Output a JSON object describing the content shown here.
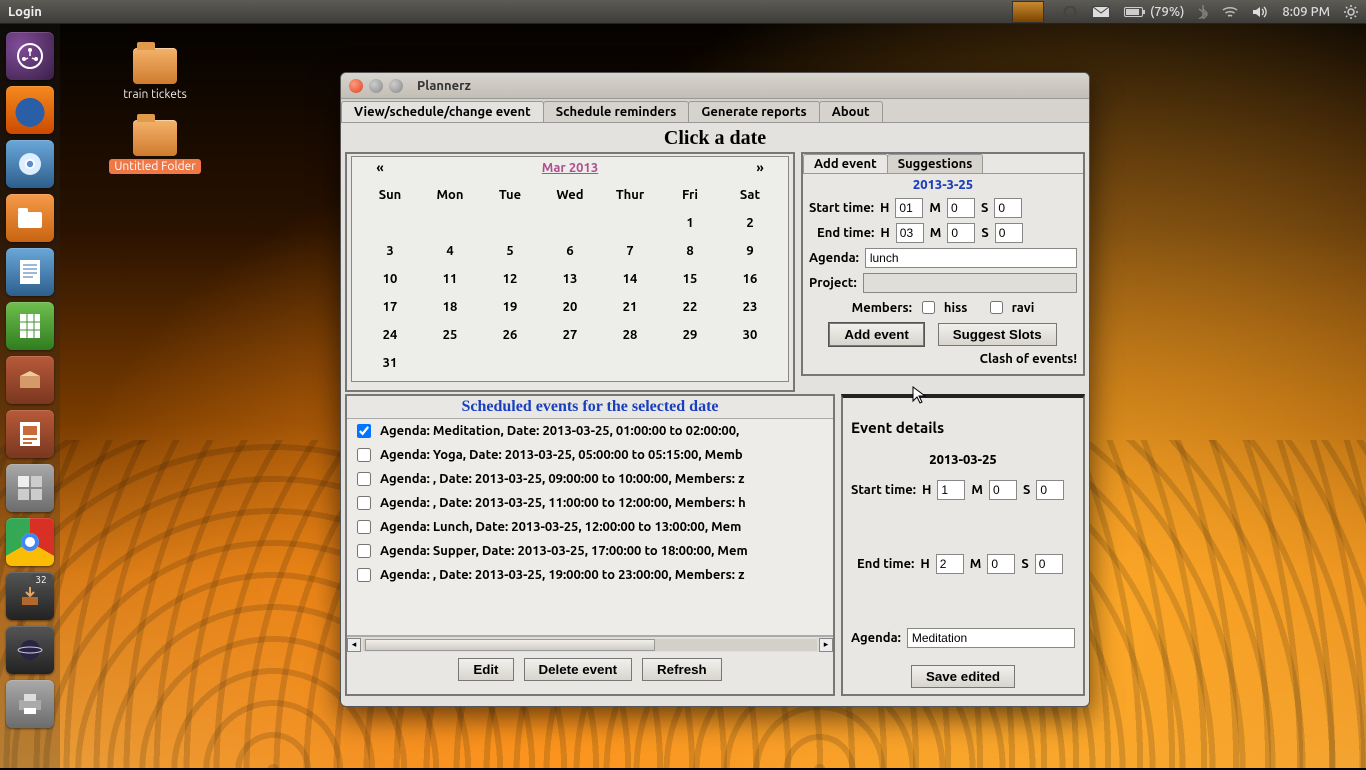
{
  "top_panel": {
    "title": "Login",
    "battery_text": "(79%)",
    "time": "8:09 PM"
  },
  "launcher": {
    "badge": "32"
  },
  "desktop": {
    "folder1": "train tickets",
    "folder2": "Untitled Folder"
  },
  "window": {
    "title": "Plannerz",
    "tabs": {
      "t1": "View/schedule/change event",
      "t2": "Schedule reminders",
      "t3": "Generate reports",
      "t4": "About"
    },
    "click_a_date": "Click a date",
    "calendar": {
      "month_label": "Mar 2013",
      "prev": "«",
      "next": "»",
      "dow": {
        "sun": "Sun",
        "mon": "Mon",
        "tue": "Tue",
        "wed": "Wed",
        "thu": "Thur",
        "fri": "Fri",
        "sat": "Sat"
      }
    },
    "right": {
      "tab_add": "Add event",
      "tab_sugg": "Suggestions",
      "date": "2013-3-25",
      "start_label": "Start time:",
      "end_label": "End time:",
      "H": "H",
      "M": "M",
      "S": "S",
      "start_h": "01",
      "start_m": "0",
      "start_s": "0",
      "end_h": "03",
      "end_m": "0",
      "end_s": "0",
      "agenda_label": "Agenda:",
      "agenda_value": "lunch",
      "project_label": "Project:",
      "project_value": "",
      "members_label": "Members:",
      "member1": "hiss",
      "member2": "ravi",
      "add_btn": "Add event",
      "suggest_btn": "Suggest Slots",
      "clash": "Clash of events!"
    },
    "events": {
      "title": "Scheduled events for the selected date",
      "items": {
        "e0": "Agenda: Meditation, Date: 2013-03-25, 01:00:00 to 02:00:00, ",
        "e1": "Agenda: Yoga, Date: 2013-03-25, 05:00:00 to 05:15:00, Memb",
        "e2": "Agenda: , Date: 2013-03-25, 09:00:00 to 10:00:00, Members: z",
        "e3": "Agenda: , Date: 2013-03-25, 11:00:00 to 12:00:00, Members: h",
        "e4": "Agenda: Lunch, Date: 2013-03-25, 12:00:00 to 13:00:00, Mem",
        "e5": "Agenda: Supper, Date: 2013-03-25, 17:00:00 to 18:00:00, Mem",
        "e6": "Agenda: , Date: 2013-03-25, 19:00:00 to 23:00:00, Members: z"
      },
      "edit": "Edit",
      "delete": "Delete event",
      "refresh": "Refresh"
    },
    "details": {
      "title": "Event details",
      "date": "2013-03-25",
      "start_label": "Start time:",
      "end_label": "End time:",
      "H": "H",
      "M": "M",
      "S": "S",
      "sh": "1",
      "sm": "0",
      "ss": "0",
      "eh": "2",
      "em": "0",
      "es": "0",
      "agenda_label": "Agenda:",
      "agenda_value": "Meditation",
      "save": "Save edited"
    }
  }
}
